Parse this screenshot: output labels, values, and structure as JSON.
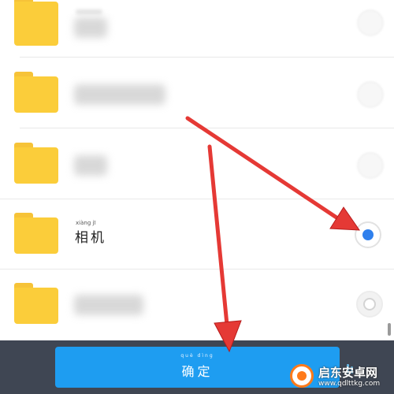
{
  "folder_list": {
    "items": [
      {
        "id": "folder-1",
        "label": "",
        "selected": false
      },
      {
        "id": "folder-2",
        "label": "",
        "selected": false
      },
      {
        "id": "folder-3",
        "label": "",
        "selected": false
      },
      {
        "id": "folder-4",
        "label": "相机",
        "pinyin": "xiàng  jī",
        "selected": true
      },
      {
        "id": "folder-5",
        "label": "",
        "selected": false
      }
    ]
  },
  "footer": {
    "confirm_label": "确定",
    "confirm_pinyin": "què  dìng"
  },
  "watermark": {
    "title": "启东安卓网",
    "url": "www.qdlttkg.com"
  },
  "colors": {
    "folder": "#fbcd3a",
    "accent": "#1e9df1",
    "radio_selected": "#2f80ed",
    "footer_bg": "#3f4653",
    "arrow": "#e53935"
  }
}
